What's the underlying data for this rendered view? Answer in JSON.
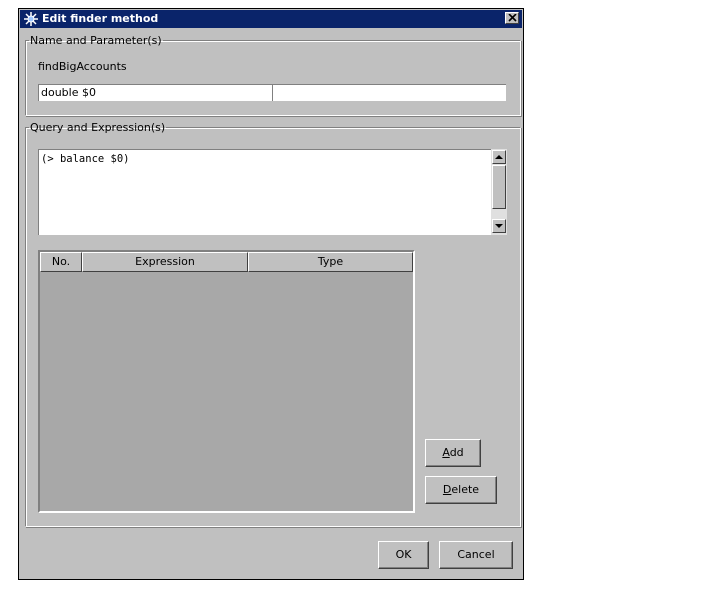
{
  "window": {
    "title": "Edit finder method"
  },
  "name_group": {
    "legend": "Name and Parameter(s)",
    "method_name": "findBigAccounts",
    "parameter_type": "double $0",
    "parameter_value": ""
  },
  "query_group": {
    "legend": "Query and Expression(s)",
    "query_text": "(> balance $0)",
    "table": {
      "columns": [
        "No.",
        "Expression",
        "Type"
      ],
      "rows": []
    },
    "add_button": {
      "mnemonic": "A",
      "rest": "dd"
    },
    "delete_button": {
      "mnemonic": "D",
      "rest": "elete"
    }
  },
  "footer": {
    "ok_label": "OK",
    "cancel_label": "Cancel"
  },
  "colors": {
    "titlebar": "#0a246a",
    "dialog": "#c0c0c0",
    "table_bg": "#a8a8a8"
  }
}
